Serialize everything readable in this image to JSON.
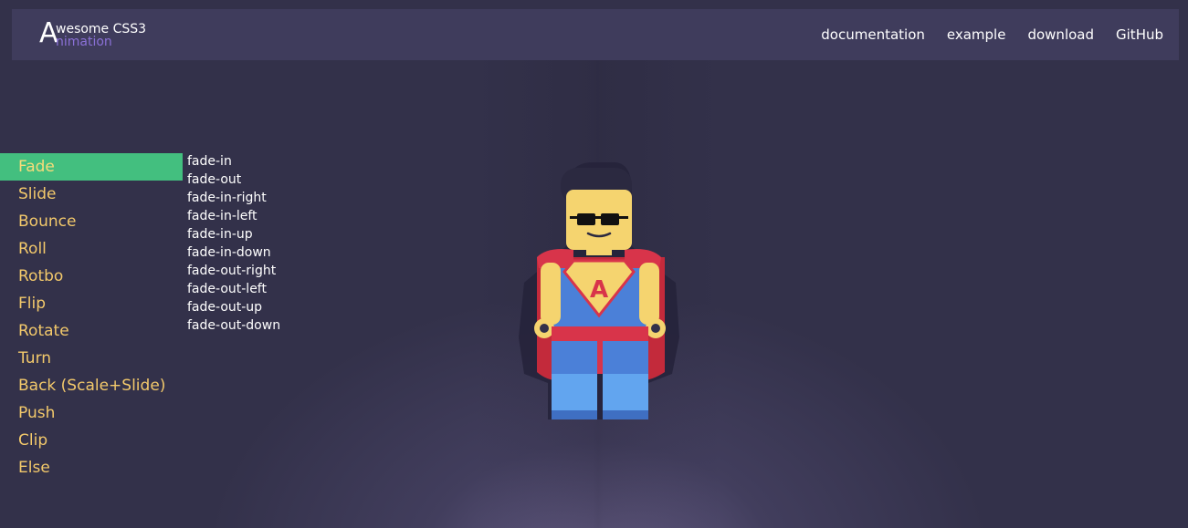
{
  "logo": {
    "letter": "A",
    "line1": "wesome CSS3",
    "line2": "nimation"
  },
  "nav": {
    "items": [
      {
        "label": "documentation"
      },
      {
        "label": "example"
      },
      {
        "label": "download"
      },
      {
        "label": "GitHub"
      }
    ]
  },
  "categories": {
    "active_index": 0,
    "items": [
      {
        "label": "Fade"
      },
      {
        "label": "Slide"
      },
      {
        "label": "Bounce"
      },
      {
        "label": "Roll"
      },
      {
        "label": "Rotbo"
      },
      {
        "label": "Flip"
      },
      {
        "label": "Rotate"
      },
      {
        "label": "Turn"
      },
      {
        "label": "Back (Scale+Slide)"
      },
      {
        "label": "Push"
      },
      {
        "label": "Clip"
      },
      {
        "label": "Else"
      }
    ]
  },
  "effects": {
    "items": [
      {
        "label": "fade-in"
      },
      {
        "label": "fade-out"
      },
      {
        "label": "fade-in-right"
      },
      {
        "label": "fade-in-left"
      },
      {
        "label": "fade-in-up"
      },
      {
        "label": "fade-in-down"
      },
      {
        "label": "fade-out-right"
      },
      {
        "label": "fade-out-left"
      },
      {
        "label": "fade-out-up"
      },
      {
        "label": "fade-out-down"
      }
    ]
  },
  "figure": {
    "emblem_letter": "A"
  },
  "colors": {
    "background": "#33314a",
    "header": "#3f3c5c",
    "active_item": "#43bf7f",
    "menu_text": "#f3c96b",
    "logo_accent": "#8a70d6"
  }
}
